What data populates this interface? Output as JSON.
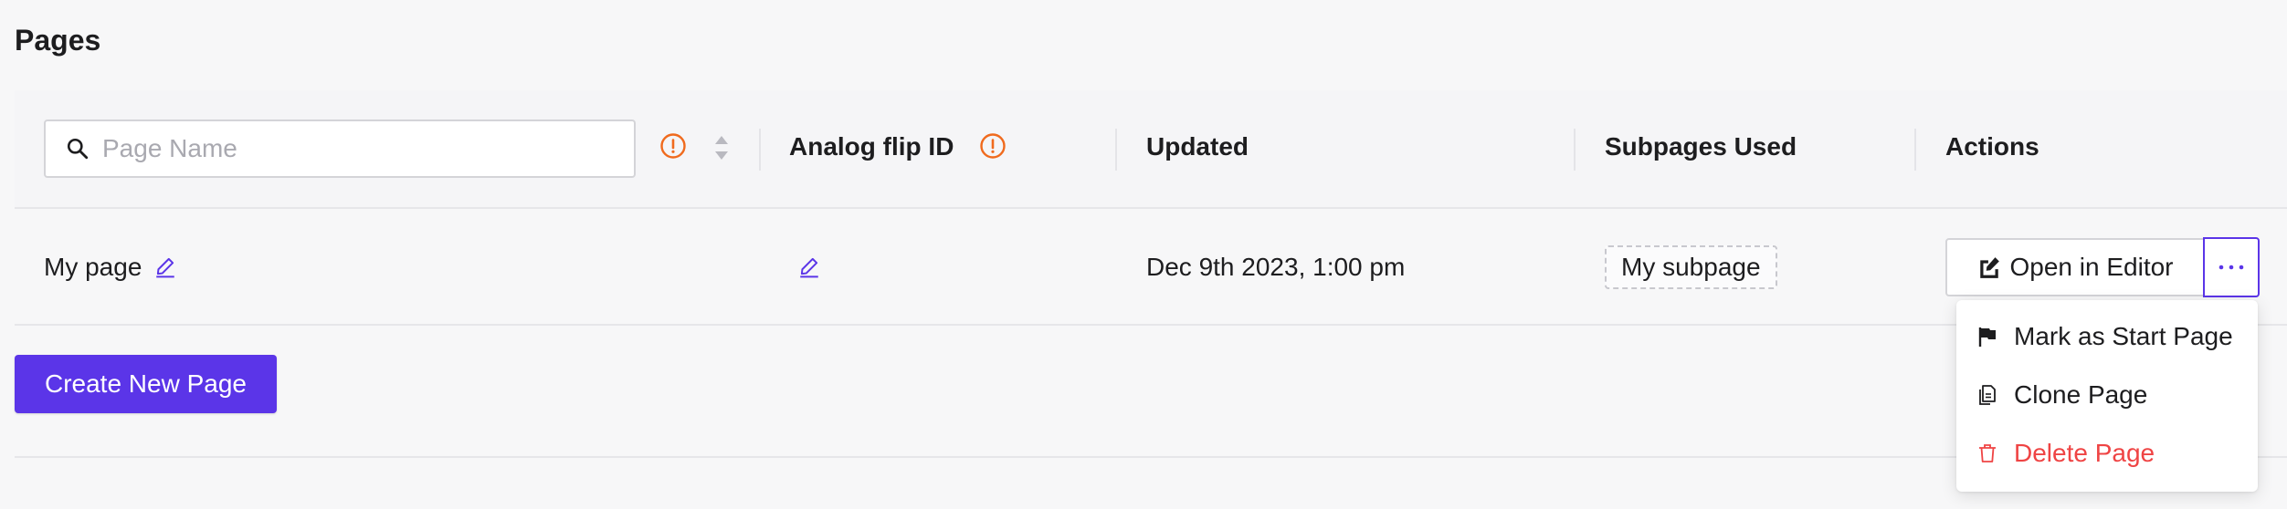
{
  "page": {
    "title": "Pages"
  },
  "table": {
    "search": {
      "placeholder": "Page Name",
      "value": ""
    },
    "columns": {
      "analog_flip_id": "Analog flip ID",
      "updated": "Updated",
      "subpages_used": "Subpages Used",
      "actions": "Actions"
    },
    "rows": [
      {
        "name": "My page",
        "analog_flip_id": "",
        "updated": "Dec 9th 2023, 1:00 pm",
        "subpage": "My subpage",
        "open_label": "Open in Editor"
      }
    ]
  },
  "create_button": {
    "label": "Create New Page"
  },
  "actions_menu": {
    "items": [
      {
        "label": "Mark as Start Page",
        "icon": "flag-icon"
      },
      {
        "label": "Clone Page",
        "icon": "clone-icon"
      },
      {
        "label": "Delete Page",
        "icon": "trash-icon"
      }
    ]
  },
  "colors": {
    "accent": "#5b35e8",
    "warning": "#f06a1d",
    "danger": "#ef4444",
    "background": "#f7f7f8"
  }
}
